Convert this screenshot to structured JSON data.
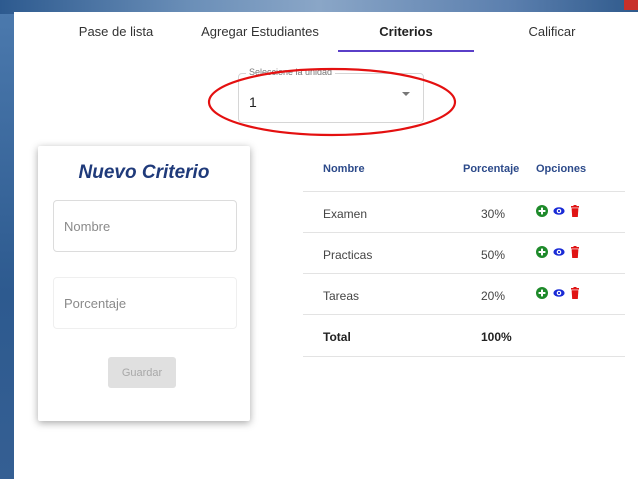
{
  "tabs": [
    {
      "label": "Pase de lista",
      "active": false
    },
    {
      "label": "Agregar Estudiantes",
      "active": false
    },
    {
      "label": "Criterios",
      "active": true
    },
    {
      "label": "Calificar",
      "active": false
    }
  ],
  "unit_select": {
    "label": "Seleccione la unidad",
    "value": "1"
  },
  "form": {
    "title": "Nuevo Criterio",
    "nombre_placeholder": "Nombre",
    "porcentaje_placeholder": "Porcentaje",
    "save_label": "Guardar"
  },
  "table": {
    "headers": {
      "name": "Nombre",
      "percent": "Porcentaje",
      "options": "Opciones"
    },
    "rows": [
      {
        "name": "Examen",
        "percent": "30%"
      },
      {
        "name": "Practicas",
        "percent": "50%"
      },
      {
        "name": "Tareas",
        "percent": "20%"
      }
    ],
    "total": {
      "name": "Total",
      "percent": "100%"
    }
  },
  "icons": {
    "add": "plus-circle-icon",
    "view": "eye-icon",
    "delete": "trash-icon"
  },
  "colors": {
    "accent": "#5a3fc8",
    "title": "#1f3a7a",
    "header_text": "#2c4a8a",
    "add_icon": "#1e8a2a",
    "view_icon": "#1a2bd6",
    "delete_icon": "#e01414",
    "annotation": "#e41010"
  }
}
